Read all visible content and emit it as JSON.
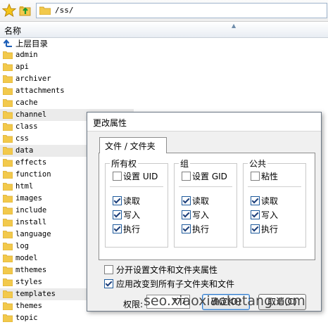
{
  "toolbar": {
    "path": "/ss/",
    "favorite_icon": "star-icon",
    "up_icon": "up-folder-icon"
  },
  "list_header": {
    "name_column": "名称"
  },
  "files": [
    {
      "name": "上层目录",
      "kind": "up"
    },
    {
      "name": "admin",
      "kind": "folder"
    },
    {
      "name": "api",
      "kind": "folder"
    },
    {
      "name": "archiver",
      "kind": "folder"
    },
    {
      "name": "attachments",
      "kind": "folder"
    },
    {
      "name": "cache",
      "kind": "folder"
    },
    {
      "name": "channel",
      "kind": "folder",
      "highlight": true
    },
    {
      "name": "class",
      "kind": "folder"
    },
    {
      "name": "css",
      "kind": "folder"
    },
    {
      "name": "data",
      "kind": "folder",
      "highlight": true
    },
    {
      "name": "effects",
      "kind": "folder"
    },
    {
      "name": "function",
      "kind": "folder"
    },
    {
      "name": "html",
      "kind": "folder"
    },
    {
      "name": "images",
      "kind": "folder"
    },
    {
      "name": "include",
      "kind": "folder"
    },
    {
      "name": "install",
      "kind": "folder"
    },
    {
      "name": "language",
      "kind": "folder"
    },
    {
      "name": "log",
      "kind": "folder"
    },
    {
      "name": "model",
      "kind": "folder"
    },
    {
      "name": "mthemes",
      "kind": "folder"
    },
    {
      "name": "styles",
      "kind": "folder"
    },
    {
      "name": "templates",
      "kind": "folder",
      "highlight": true
    },
    {
      "name": "themes",
      "kind": "folder"
    },
    {
      "name": "topic",
      "kind": "folder"
    }
  ],
  "dialog": {
    "title": "更改属性",
    "tab": "文件 / 文件夹",
    "groups": {
      "owner": {
        "title": "所有权",
        "special": "设置 UID",
        "special_checked": false,
        "read": "读取",
        "write": "写入",
        "exec": "执行"
      },
      "group": {
        "title": "组",
        "special": "设置 GID",
        "special_checked": false,
        "read": "读取",
        "write": "写入",
        "exec": "执行"
      },
      "public": {
        "title": "公共",
        "special": "粘性",
        "special_checked": false,
        "read": "读取",
        "write": "写入",
        "exec": "执行"
      }
    },
    "option_separate": {
      "label": "分开设置文件和文件夹属性",
      "checked": false
    },
    "option_recursive": {
      "label": "应用改变到所有子文件夹和文件",
      "checked": true
    },
    "permission_label": "权限:",
    "permission_value": "777",
    "ok_button": "确定(O)",
    "cancel_button": "取消(C)"
  },
  "watermark": "seo.xiaoxiaoketang.com",
  "colors": {
    "folder": "#f2c94c",
    "folder_dark": "#d9a92a",
    "selection": "#ebebeb",
    "dialog_bg": "#f0f0f0",
    "accent": "#3a7bc8"
  }
}
